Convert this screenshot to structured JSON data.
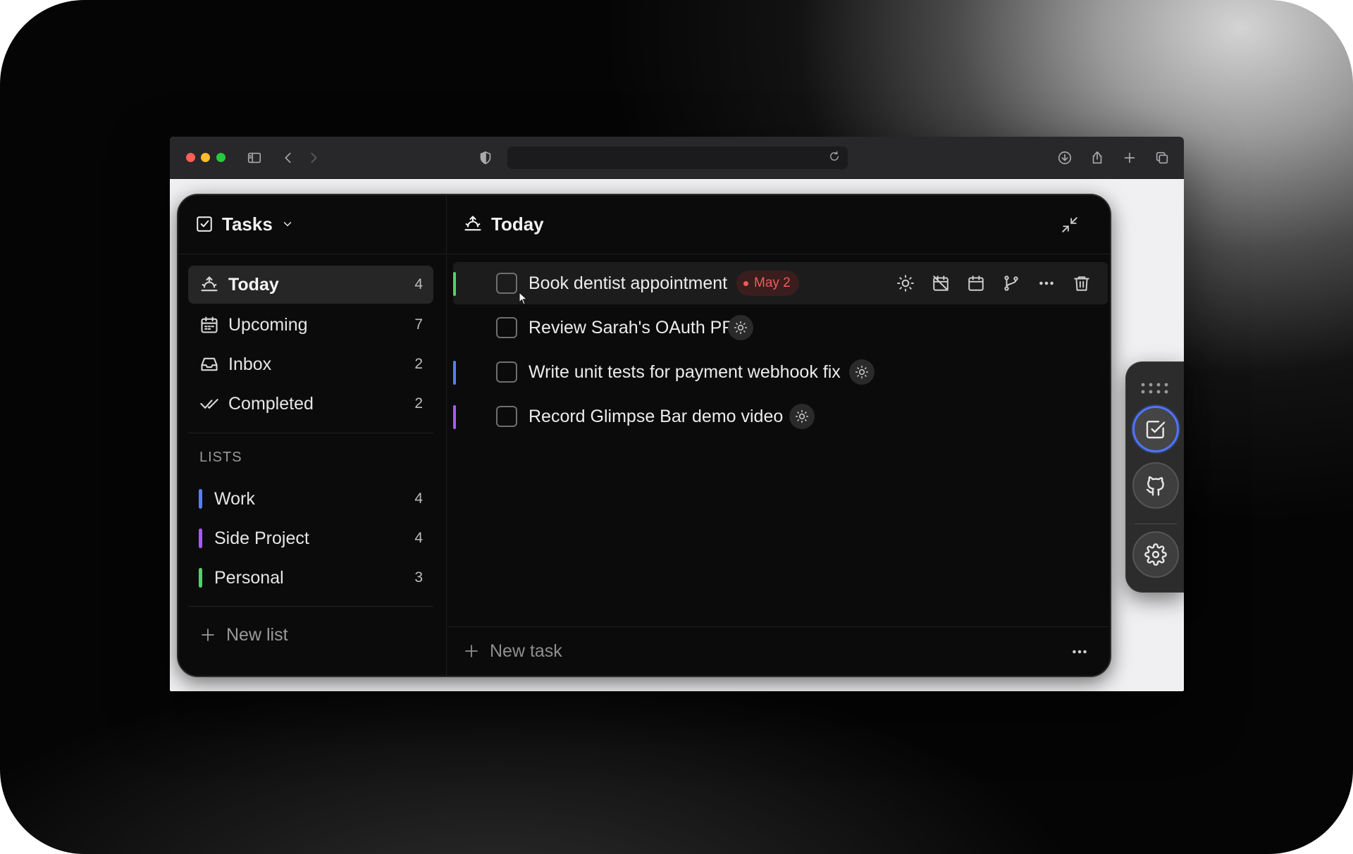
{
  "app": {
    "title": "Tasks",
    "nav": [
      {
        "label": "Today",
        "count": "4",
        "icon": "sunrise-icon",
        "active": true
      },
      {
        "label": "Upcoming",
        "count": "7",
        "icon": "calendar-icon"
      },
      {
        "label": "Inbox",
        "count": "2",
        "icon": "inbox-icon"
      },
      {
        "label": "Completed",
        "count": "2",
        "icon": "double-check-icon"
      }
    ],
    "lists_heading": "LISTS",
    "lists": [
      {
        "label": "Work",
        "count": "4",
        "color": "#5b7cff"
      },
      {
        "label": "Side Project",
        "count": "4",
        "color": "#a35bff"
      },
      {
        "label": "Personal",
        "count": "3",
        "color": "#4fd36b"
      }
    ],
    "new_list_label": "New list"
  },
  "main": {
    "title": "Today",
    "tasks": [
      {
        "title": "Book dentist appointment",
        "date_badge": "May 2",
        "accent": "#4fd36b"
      },
      {
        "title": "Review Sarah's OAuth PR",
        "accent": ""
      },
      {
        "title": "Write unit tests for payment webhook fix",
        "accent": "#5b7cff"
      },
      {
        "title": "Record Glimpse Bar demo video",
        "accent": "#a35bff"
      }
    ],
    "new_task_label": "New task"
  },
  "colors": {
    "accent_blue": "#4f75ff",
    "date_red": "#ec5c5c"
  }
}
